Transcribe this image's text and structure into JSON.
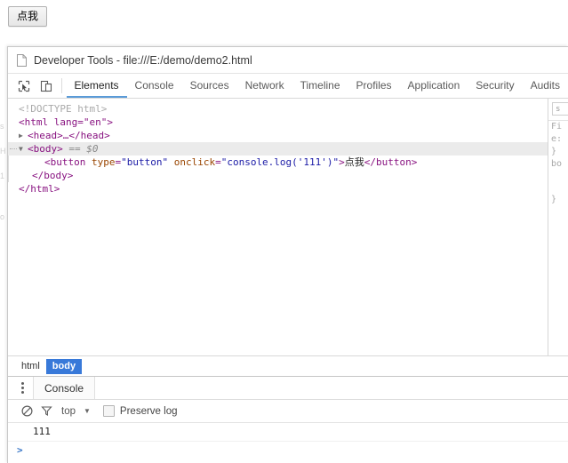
{
  "page": {
    "button_label": "点我",
    "ghost_chars": [
      "s",
      "H",
      "1",
      "o"
    ]
  },
  "devtools": {
    "title": "Developer Tools - file:///E:/demo/demo2.html",
    "title_icon": "page-icon",
    "toolbar": {
      "inspect_icon": "inspect-element-icon",
      "device_icon": "device-toolbar-icon"
    },
    "tabs": [
      {
        "label": "Elements",
        "active": true
      },
      {
        "label": "Console",
        "active": false
      },
      {
        "label": "Sources",
        "active": false
      },
      {
        "label": "Network",
        "active": false
      },
      {
        "label": "Timeline",
        "active": false
      },
      {
        "label": "Profiles",
        "active": false
      },
      {
        "label": "Application",
        "active": false
      },
      {
        "label": "Security",
        "active": false
      },
      {
        "label": "Audits",
        "active": false
      }
    ],
    "active_tab_underline_color": "#5a9bd8",
    "dom": {
      "doctype": "<!DOCTYPE html>",
      "html_open": "<html lang=\"en\">",
      "head_collapsed": "<head>…</head>",
      "body_open": "<body>",
      "body_selected_marker": "== $0",
      "button_tag_open": "<button",
      "button_attr1_name": "type",
      "button_attr1_value": "\"button\"",
      "button_attr2_name": "onclick",
      "button_attr2_value": "\"console.log('111')\"",
      "button_gt": ">",
      "button_text": "点我",
      "button_close": "</button>",
      "body_close": "</body>",
      "html_close": "</html>"
    },
    "sidebar": {
      "search_placeholder": "s",
      "lines": [
        "Fi",
        "e:",
        "}",
        "bo",
        "}"
      ]
    },
    "breadcrumb": [
      {
        "label": "html",
        "active": false
      },
      {
        "label": "body",
        "active": true
      }
    ],
    "drawer": {
      "menu_icon": "more-options-icon",
      "tab_label": "Console",
      "clear_icon": "clear-console-icon",
      "filter_icon": "filter-icon",
      "context_label": "top",
      "context_arrow_icon": "chevron-down-icon",
      "preserve_log_label": "Preserve log",
      "preserve_log_checked": false,
      "messages": [
        "111"
      ],
      "prompt_symbol": ">"
    }
  }
}
